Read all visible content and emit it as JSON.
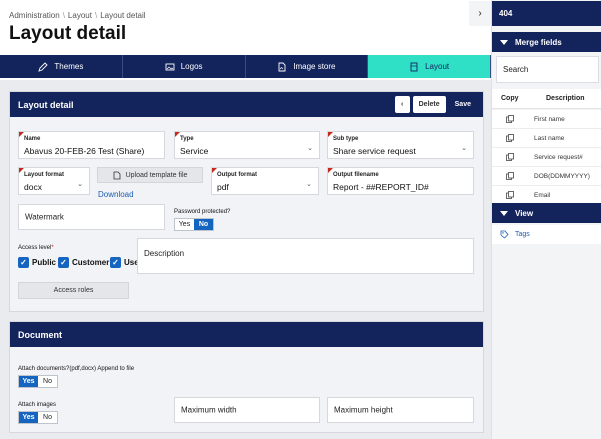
{
  "breadcrumb": {
    "items": [
      "Administration",
      "Layout",
      "Layout detail"
    ],
    "sep": "\\"
  },
  "page_title": "Layout detail",
  "tabs": [
    {
      "label": "Themes",
      "icon": "pen-icon"
    },
    {
      "label": "Logos",
      "icon": "image-icon"
    },
    {
      "label": "Image store",
      "icon": "file-image-icon"
    },
    {
      "label": "Layout",
      "icon": "layout-icon",
      "active": true
    }
  ],
  "layout_panel": {
    "title": "Layout detail",
    "back_label": "‹",
    "delete_label": "Delete",
    "save_label": "Save",
    "name": {
      "label": "Name",
      "value": "Abavus 20-FEB-26 Test (Share)"
    },
    "type": {
      "label": "Type",
      "value": "Service"
    },
    "sub_type": {
      "label": "Sub type",
      "value": "Share service request"
    },
    "layout_format": {
      "label": "Layout format",
      "value": "docx"
    },
    "upload_label": "Upload template file",
    "download_label": "Download",
    "output_format": {
      "label": "Output format",
      "value": "pdf"
    },
    "output_filename": {
      "label": "Output filename",
      "value": "Report - ##REPORT_ID#"
    },
    "watermark_placeholder": "Watermark",
    "password_protected": {
      "label": "Password protected?",
      "yes": "Yes",
      "no": "No",
      "selected": "No"
    },
    "access_level": {
      "label": "Access level",
      "required": "*",
      "options": [
        "Public",
        "Customer",
        "Use"
      ]
    },
    "description_placeholder": "Description",
    "access_roles_label": "Access roles"
  },
  "document_panel": {
    "title": "Document",
    "attach_documents": {
      "label": "Attach documents?(pdf,docx) Append to file",
      "yes": "Yes",
      "no": "No",
      "selected": "Yes"
    },
    "attach_images": {
      "label": "Attach images",
      "yes": "Yes",
      "no": "No",
      "selected": "Yes"
    },
    "max_width_placeholder": "Maximum width",
    "max_height_placeholder": "Maximum height"
  },
  "sidebar": {
    "collapse_icon": "chevron-right-icon",
    "top_label": "404",
    "merge_fields_label": "Merge fields",
    "search_placeholder": "Search",
    "columns": [
      "Copy",
      "Description"
    ],
    "rows": [
      "First name",
      "Last name",
      "Service request#",
      "DOB(DDMMYYYY)",
      "Email"
    ],
    "view_label": "View",
    "tags_label": "Tags"
  },
  "colors": {
    "navy": "#13235c",
    "accent": "#2fe0c7",
    "blue": "#1565c0",
    "required": "#c5281c"
  }
}
